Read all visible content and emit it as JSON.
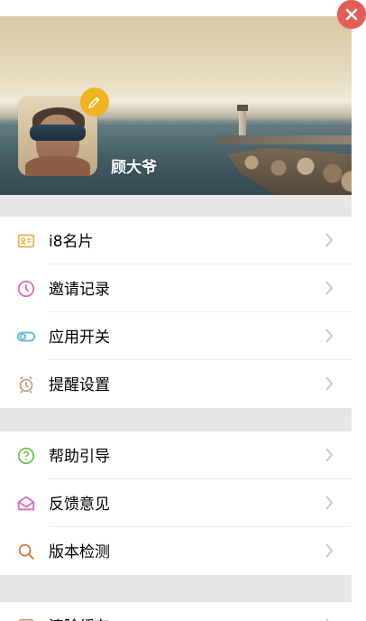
{
  "profile": {
    "name": "顾大爷"
  },
  "menu": {
    "group1": [
      {
        "label": "i8名片",
        "icon": "id-card-icon"
      },
      {
        "label": "邀请记录",
        "icon": "clock-icon"
      },
      {
        "label": "应用开关",
        "icon": "toggle-icon"
      },
      {
        "label": "提醒设置",
        "icon": "alarm-clock-icon"
      }
    ],
    "group2": [
      {
        "label": "帮助引导",
        "icon": "help-icon"
      },
      {
        "label": "反馈意见",
        "icon": "envelope-icon"
      },
      {
        "label": "版本检测",
        "icon": "search-icon"
      }
    ],
    "group3": [
      {
        "label": "清除缓存",
        "icon": "cache-icon"
      }
    ]
  },
  "colors": {
    "close": "#e35d57",
    "edit": "#f0b322",
    "idCard": "#e9b44c",
    "clock": "#d86bc4",
    "toggle": "#62b9d6",
    "alarm": "#bfa576",
    "help": "#79bf58",
    "envelope": "#d86bc4",
    "search": "#d97b3c"
  }
}
